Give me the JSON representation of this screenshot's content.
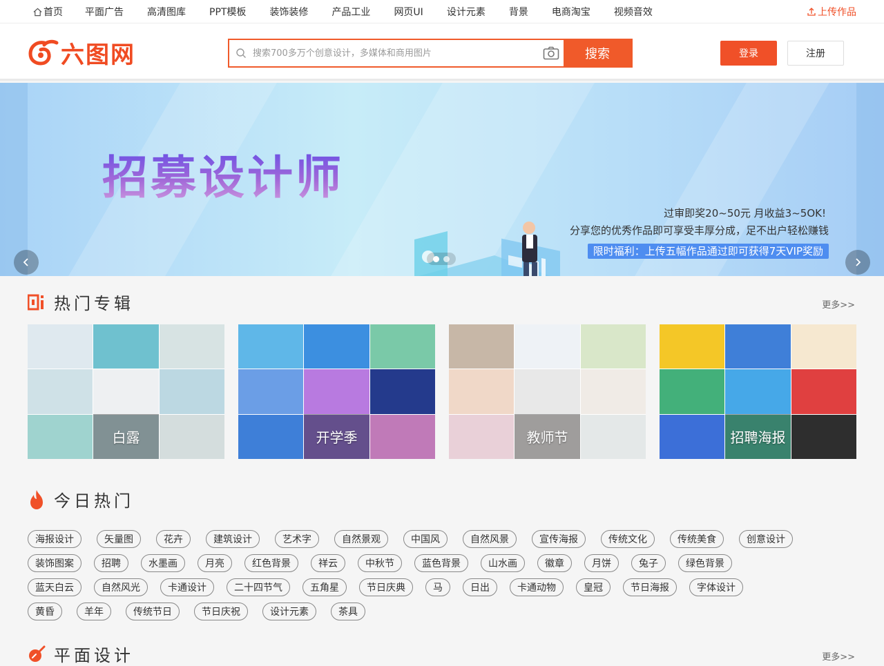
{
  "topnav": {
    "links": [
      "首页",
      "平面广告",
      "高清图库",
      "PPT模板",
      "装饰装修",
      "产品工业",
      "网页UI",
      "设计元素",
      "背景",
      "电商淘宝",
      "视频音效"
    ],
    "upload": "上传作品"
  },
  "header": {
    "logo_text": "六图网",
    "search_placeholder": "搜索700多万个创意设计，多媒体和商用图片",
    "search_button": "搜索",
    "login": "登录",
    "register": "注册"
  },
  "banner": {
    "title": "招募设计师",
    "line1": "过审即奖20~50元 月收益3~5OK!",
    "line2": "分享您的优秀作品即可享受丰厚分成，足不出户轻松赚钱",
    "line3": "限时福利：上传五幅作品通过即可获得7天VIP奖励",
    "active_slide": 1,
    "slide_count": 2
  },
  "hot_albums": {
    "title": "热门专辑",
    "more": "更多>>",
    "items": [
      {
        "label": "白露",
        "colors": [
          "#dfe9ef",
          "#6fc1cf",
          "#d7e3e3",
          "#cfe1e7",
          "#eef0f2",
          "#bcd8e2",
          "#9fd3cf",
          "#c7dfe4",
          "#d4dddd"
        ]
      },
      {
        "label": "开学季",
        "colors": [
          "#5fb7e8",
          "#3c8fe0",
          "#7ac9a8",
          "#6b9ee6",
          "#b87ae0",
          "#243a8c",
          "#3e7fd8",
          "#9a7ad8",
          "#c07ab8"
        ]
      },
      {
        "label": "教师节",
        "colors": [
          "#c7b7a7",
          "#eef2f6",
          "#d9e7c9",
          "#f0d8c8",
          "#e8e8e8",
          "#f0ebe6",
          "#e9d0d8",
          "#f4f2f0",
          "#e4e8e8"
        ]
      },
      {
        "label": "招聘海报",
        "colors": [
          "#f4c727",
          "#3f7fd8",
          "#f6e8d0",
          "#43b07a",
          "#46a8e8",
          "#e04040",
          "#3c6fd8",
          "#58c8a8",
          "#2e2e2e"
        ]
      }
    ]
  },
  "today_hot": {
    "title": "今日热门",
    "rows": [
      [
        "海报设计",
        "矢量图",
        "花卉",
        "建筑设计",
        "艺术字",
        "自然景观",
        "中国风",
        "自然风景",
        "宣传海报",
        "传统文化",
        "传统美食",
        "创意设计"
      ],
      [
        "装饰图案",
        "招聘",
        "水墨画",
        "月亮",
        "红色背景",
        "祥云",
        "中秋节",
        "蓝色背景",
        "山水画",
        "徽章",
        "月饼",
        "兔子",
        "绿色背景"
      ],
      [
        "蓝天白云",
        "自然风光",
        "卡通设计",
        "二十四节气",
        "五角星",
        "节日庆典",
        "马",
        "日出",
        "卡通动物",
        "皇冠",
        "节日海报",
        "字体设计"
      ],
      [
        "黄昏",
        "羊年",
        "传统节日",
        "节日庆祝",
        "设计元素",
        "茶具"
      ]
    ]
  },
  "graphic_design": {
    "title": "平面设计",
    "more": "更多>>"
  }
}
